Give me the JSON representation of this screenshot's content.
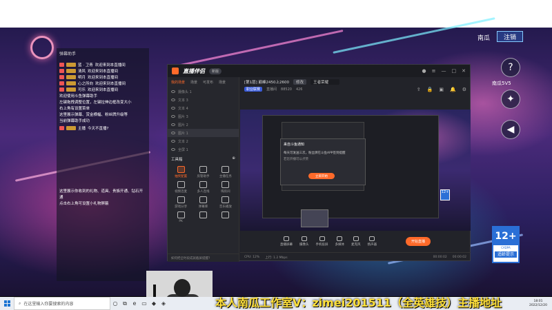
{
  "chat": {
    "title": "弹幕助手",
    "rows": [
      {
        "user": "蓝 · 卫青",
        "text": "欢迎来到本直播间"
      },
      {
        "user": "清风",
        "text": "欢迎来到本直播间"
      },
      {
        "user": "明月",
        "text": "欢迎来到本直播间"
      },
      {
        "user": "心之所向",
        "text": "欢迎来到本直播间"
      },
      {
        "user": "可乐",
        "text": "欢迎来到本直播间"
      }
    ],
    "system_lines": [
      "欢迎使用斗鱼弹幕助手",
      "左键拖拽调整位置，左键拉伸边框改变大小",
      "右上角有设置菜单",
      "这里展示弹幕、赏金横幅、粉丝牌升级等",
      "当前弹幕助手成功"
    ],
    "last_msg": {
      "user": "主播",
      "text": "今天不直播?"
    },
    "bottom_lines": [
      "这里展示你收到的礼物、道具、贵族开通、钻石开通",
      "点击右上角可设置小礼物屏蔽"
    ]
  },
  "app": {
    "name": "直播伴侣",
    "version_badge": "新版",
    "left_tabs": [
      "我的场景",
      "场景",
      "可发布",
      "场景"
    ],
    "sources": [
      "摄像头 1",
      "文本 3",
      "文本 4",
      "图片 3",
      "图片 2",
      "图片 1",
      "文本 2",
      "全屏 1"
    ],
    "toolbox_label": "工具箱",
    "tools": [
      "抽奖配置",
      "房管助手",
      "主播任务",
      "视频连麦",
      "多人连线",
      "嗨房间",
      "游戏分享",
      "弹幕库",
      "音乐播放",
      "PK",
      "",
      ""
    ],
    "left_footer": "如何把全时段成就截屏提醒?",
    "room_title": "[第1层] 巅峰2450上2600",
    "edit_label": "修改",
    "category": "王者荣耀",
    "room_id": "88520",
    "room_prefix": "直播间",
    "fans_count": "426",
    "line2": "职业联赛",
    "popup": {
      "title": "来自斗鱼通知",
      "text": "每天可发送三次，粉丝牌在斗鱼APP签到提醒",
      "text2": "若您开播可以点赞",
      "button": "立即开始"
    },
    "toolbar": [
      "直播屏幕",
      "摄像头",
      "手机投屏",
      "多媒体",
      "麦克风",
      "扬声器"
    ],
    "go_live": "开始直播",
    "status": {
      "left": "CPU: 12%",
      "mid": "上行: 1.2 Mbps",
      "r1": "00:00:02",
      "r2": "00:00:02"
    }
  },
  "overlay": {
    "name": "南瓜",
    "logout": "注销",
    "mode": "南瓜5V5",
    "cadpa_num": "12+",
    "cadpa_label": "CADPA",
    "cadpa_tip": "适龄提示"
  },
  "marquee": "本人南瓜工作室V：zimei201511（全英雄技）主播地址",
  "taskbar": {
    "search_placeholder": "在这里输入你要搜索的内容",
    "time": "18:01",
    "date": "2022/12/20"
  },
  "colors": {
    "accent": "#ff6a2a",
    "cadpa_blue": "#2a6fd6",
    "marquee": "#ffe03a"
  }
}
